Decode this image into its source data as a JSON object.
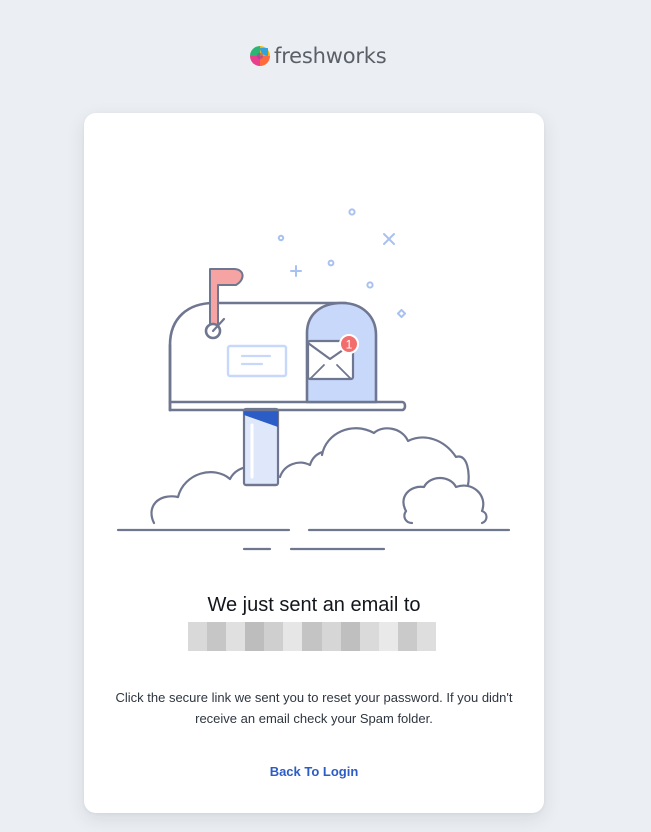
{
  "brand": {
    "name": "freshworks",
    "logo_colors": [
      "#f4b400",
      "#ff6a3d",
      "#e83e8c",
      "#8e44ad",
      "#2bb673",
      "#1da1f2"
    ]
  },
  "illustration": {
    "description_icon": "mailbox-with-letter-icon",
    "notification_count": "1",
    "colors": {
      "outline": "#6f7690",
      "flag": "#f5a3a3",
      "door_fill": "#c7d8fb",
      "badge": "#f46d6d",
      "post_accent": "#2c5cc5",
      "sparkle": "#a9c1f0"
    }
  },
  "message": {
    "headline": "We just sent an email to",
    "email_redacted": true,
    "description": "Click the secure link we sent you to reset your password. If you didn't receive an email check your Spam folder."
  },
  "actions": {
    "back_to_login": "Back To Login"
  },
  "colors": {
    "page_background": "#ebeef2",
    "card_background": "#ffffff",
    "link": "#2c5cc5"
  }
}
